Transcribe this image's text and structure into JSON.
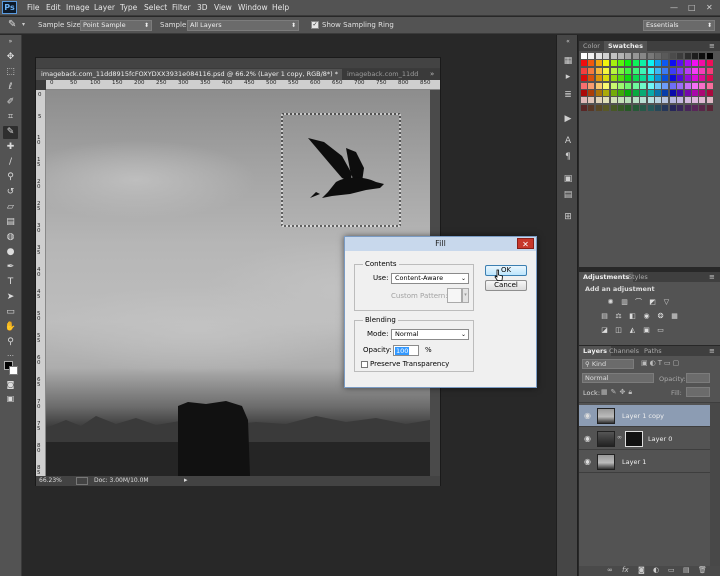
{
  "app": {
    "logo": "Ps"
  },
  "menubar": {
    "items": [
      "File",
      "Edit",
      "Image",
      "Layer",
      "Type",
      "Select",
      "Filter",
      "3D",
      "View",
      "Window",
      "Help"
    ],
    "window_controls": [
      "—",
      "□",
      "✕"
    ]
  },
  "options_bar": {
    "sample_size_label": "Sample Size:",
    "sample_size_value": "Point Sample",
    "sample_label": "Sample:",
    "sample_value": "All Layers",
    "sampling_ring_label": "Show Sampling Ring",
    "sampling_ring_checked": true,
    "workspace_value": "Essentials"
  },
  "document": {
    "active_tab": "imageback.com_11dd8915fcFOXYDXX3931e084116.psd @ 66.2% (Layer 1 copy, RGB/8*) *",
    "inactive_tab": "imageback.com_11dd",
    "ruler_h_ticks": [
      "0",
      "50",
      "100",
      "150",
      "200",
      "250",
      "300",
      "350",
      "400",
      "450",
      "500",
      "550",
      "600",
      "650",
      "700",
      "750",
      "800",
      "850"
    ],
    "ruler_v_ticks": [
      "0",
      "5",
      "1 0",
      "1 5",
      "2 0",
      "2 5",
      "3 0",
      "3 5",
      "4 0",
      "4 5",
      "5 0",
      "5 5",
      "6 0",
      "6 5",
      "7 0",
      "7 5",
      "8 0",
      "8 5"
    ],
    "zoom": "66.23%",
    "doc_size": "Doc: 3.00M/10.0M"
  },
  "fill_dialog": {
    "title": "Fill",
    "contents_label": "Contents",
    "use_label": "Use:",
    "use_value": "Content-Aware",
    "custom_pattern_label": "Custom Pattern:",
    "blending_label": "Blending",
    "mode_label": "Mode:",
    "mode_value": "Normal",
    "opacity_label": "Opacity:",
    "opacity_value": "100",
    "opacity_unit": "%",
    "preserve_transparency_label": "Preserve Transparency",
    "preserve_transparency_checked": false,
    "ok_label": "OK",
    "cancel_label": "Cancel"
  },
  "swatches_panel": {
    "tabs": [
      "Color",
      "Swatches"
    ],
    "active_tab": "Swatches"
  },
  "adjustments_panel": {
    "tabs": [
      "Adjustments",
      "Styles"
    ],
    "active_tab": "Adjustments",
    "heading": "Add an adjustment"
  },
  "layers_panel": {
    "tabs": [
      "Layers",
      "Channels",
      "Paths"
    ],
    "active_tab": "Layers",
    "filter_value": "Kind",
    "blend_mode": "Normal",
    "opacity_label": "Opacity:",
    "lock_label": "Lock:",
    "fill_label": "Fill:",
    "layers": [
      {
        "name": "Layer 1 copy",
        "selected": true
      },
      {
        "name": "Layer 0",
        "selected": false
      },
      {
        "name": "Layer 1",
        "selected": false
      }
    ],
    "footer_icons": [
      "link-icon",
      "fx-icon",
      "mask-icon",
      "adjustment-icon",
      "folder-icon",
      "new-layer-icon",
      "trash-icon"
    ]
  },
  "colors": {
    "ui_dark": "#282828",
    "panel": "#535353",
    "dialog_bg": "#f0f0f0",
    "selected_layer": "#8c9cb3",
    "close_red": "#c7372b",
    "ps_blue": "#6cb1f3"
  }
}
